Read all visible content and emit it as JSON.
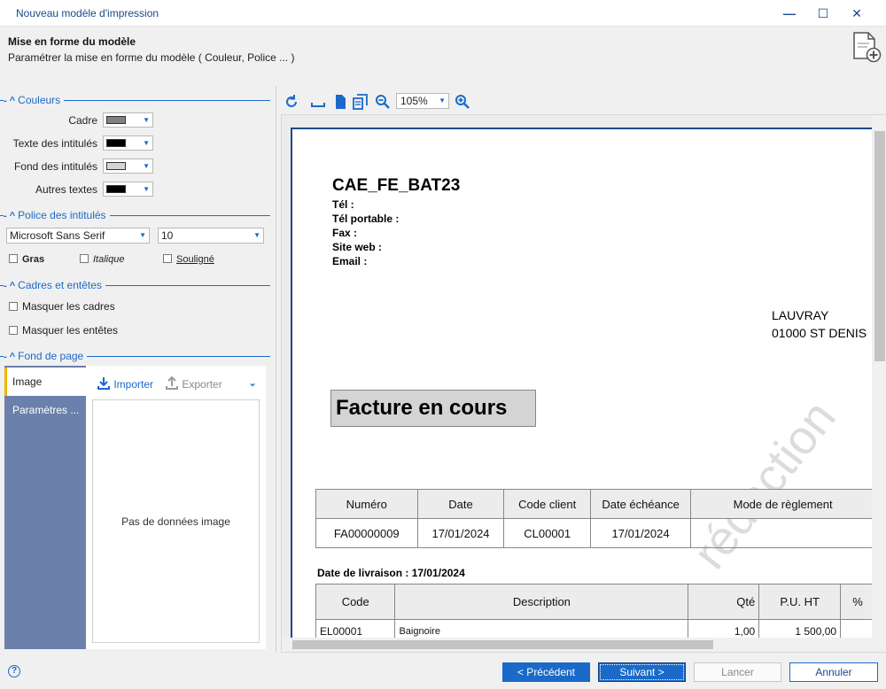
{
  "window": {
    "title": "Nouveau modèle d'impression",
    "minimize": "—",
    "maximize": "☐",
    "close": "✕"
  },
  "header": {
    "title": "Mise en forme du modèle",
    "subtitle": "Paramétrer la mise en forme du modèle ( Couleur, Police ... )"
  },
  "couleurs": {
    "title": "Couleurs",
    "rows": [
      {
        "label": "Cadre",
        "color": "#808080"
      },
      {
        "label": "Texte des intitulés",
        "color": "#000000"
      },
      {
        "label": "Fond des intitulés",
        "color": "#d4d4d4"
      },
      {
        "label": "Autres textes",
        "color": "#000000"
      }
    ]
  },
  "police": {
    "title": "Police des intitulés",
    "font": "Microsoft Sans Serif",
    "size": "10",
    "gras": "Gras",
    "italique": "Italique",
    "souligne": "Souligné"
  },
  "cadres": {
    "title": "Cadres et entêtes",
    "masquer_cadres": "Masquer les cadres",
    "masquer_entetes": "Masquer les entêtes"
  },
  "fond": {
    "title": "Fond de page",
    "tabs": [
      "Image",
      "Paramètres ..."
    ],
    "importer": "Importer",
    "exporter": "Exporter",
    "empty": "Pas de données image"
  },
  "preview": {
    "zoom": "105%",
    "company": "CAE_FE_BAT23",
    "contact_lines": [
      "Tél :",
      "Tél portable :",
      "Fax :",
      "Site web :",
      "Email :"
    ],
    "client": [
      "LAUVRAY",
      "01000 ST DENIS"
    ],
    "doc_title": "Facture en cours",
    "watermark": "rédaction",
    "table1_headers": [
      "Numéro",
      "Date",
      "Code client",
      "Date échéance",
      "Mode de règlement"
    ],
    "table1_values": [
      "FA00000009",
      "17/01/2024",
      "CL00001",
      "17/01/2024",
      ""
    ],
    "livraison": "Date de livraison : 17/01/2024",
    "table2_headers": [
      "Code",
      "Description",
      "Qté",
      "P.U. HT",
      "%"
    ],
    "table2_row": [
      "EL00001",
      "Baignoire",
      "1,00",
      "1 500,00",
      ""
    ]
  },
  "footer": {
    "help": "?",
    "precedent": "< Précédent",
    "suivant": "Suivant >",
    "lancer": "Lancer",
    "annuler": "Annuler"
  },
  "colors": {
    "accent": "#1b6ac9",
    "tabs_bg": "#6b80aa",
    "tab_active_marker": "#f0b400"
  }
}
